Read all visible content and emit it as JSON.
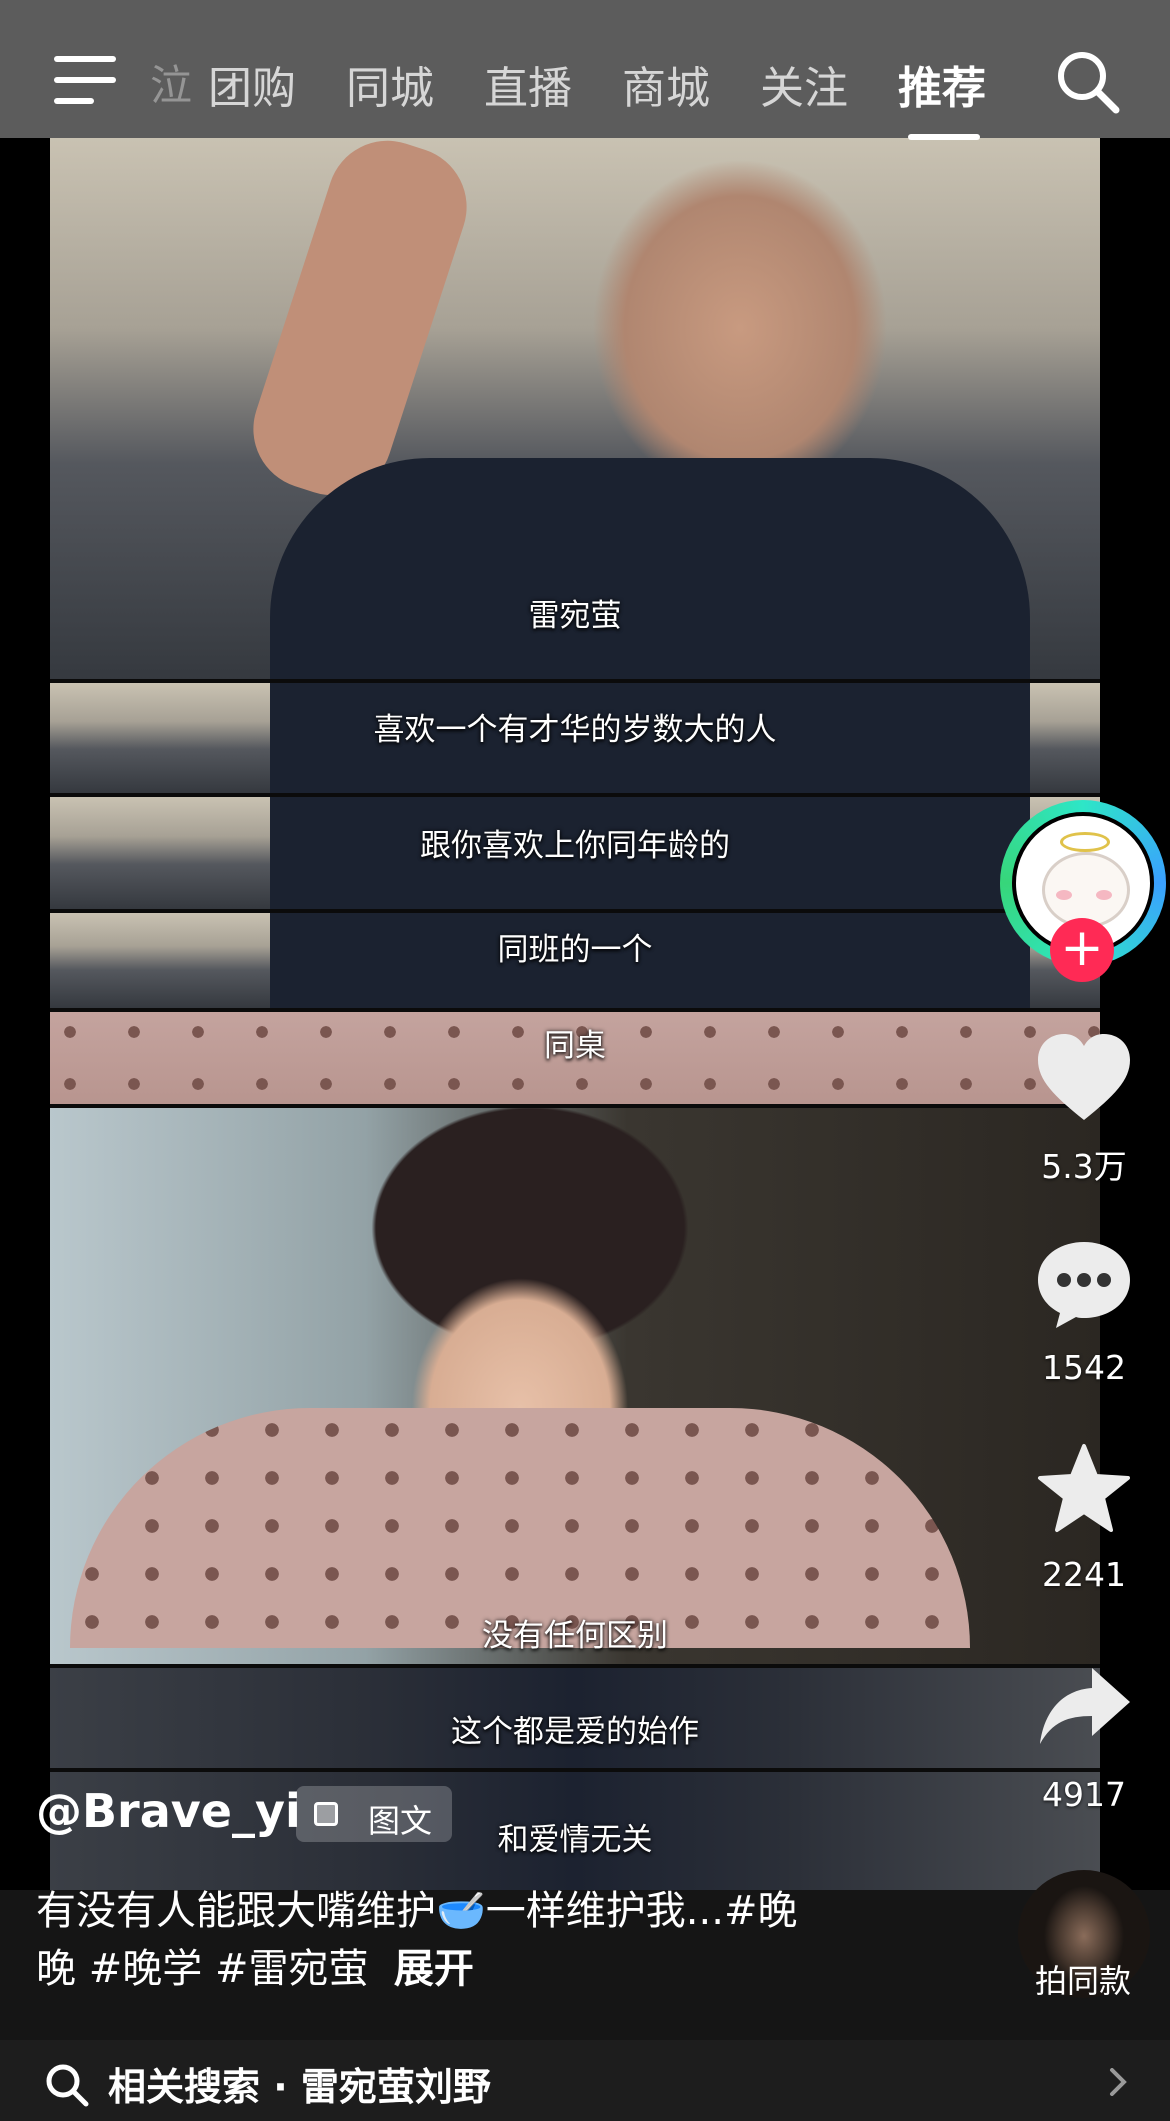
{
  "nav": {
    "partial_tab": "泣",
    "tabs": [
      "团购",
      "同城",
      "直播",
      "商城",
      "关注",
      "推荐"
    ],
    "active_tab": "推荐"
  },
  "video": {
    "subtitles": [
      "雷宛萤",
      "喜欢一个有才华的岁数大的人",
      "跟你喜欢上你同年龄的",
      "同班的一个",
      "同桌",
      "没有任何区别",
      "这个都是爱的始作",
      "和爱情无关"
    ]
  },
  "actions": {
    "likes": "5.3万",
    "comments": "1542",
    "favorites": "2241",
    "shares": "4917",
    "follow_symbol": "+"
  },
  "post": {
    "author": "@Brave_yi",
    "type_badge": "图文",
    "caption_line1": "有没有人能跟大嘴维护🥣一样维护我...#晚",
    "caption_line2": "晚 #晚学 #雷宛萤",
    "expand": "展开",
    "same_style_label": "拍同款"
  },
  "related_search": {
    "label": "相关搜索 · 雷宛萤刘野"
  }
}
